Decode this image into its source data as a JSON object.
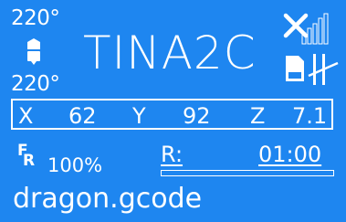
{
  "colors": {
    "background": "#1e86f0",
    "foreground": "#ffffff"
  },
  "printer": {
    "name": "TINA2C"
  },
  "temperatures": {
    "nozzle": "220°",
    "bed": "220°"
  },
  "icons": {
    "nozzle": "nozzle-icon",
    "wifi": "wifi-disconnected-icon",
    "sd": "sd-card-icon",
    "pause": "pause-icon"
  },
  "position": {
    "x_label": "X",
    "x_value": "62",
    "y_label": "Y",
    "y_value": "92",
    "z_label": "Z",
    "z_value": "7.1"
  },
  "feedrate": {
    "f_label": "F",
    "r_label": "R",
    "percent": "100%"
  },
  "remaining": {
    "label": "R:",
    "time": "01:00",
    "progress": 0
  },
  "file": {
    "name": "dragon.gcode"
  }
}
